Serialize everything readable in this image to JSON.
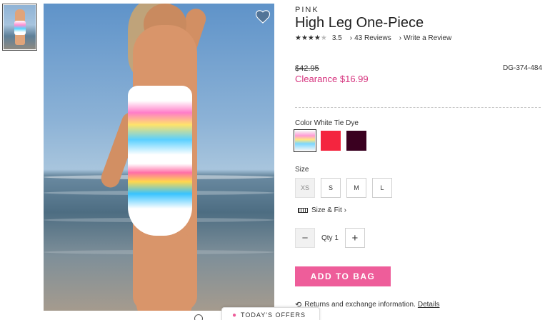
{
  "brand": "PINK",
  "product": {
    "title": "High Leg One-Piece",
    "rating": {
      "stars": "★★★",
      "half": "★",
      "empty": "★",
      "value": "3.5",
      "stars_value": 3.5
    },
    "reviews_link": "43 Reviews",
    "write_review_link": "Write a Review",
    "chevron": "›",
    "old_price": "$42.95",
    "clearance_price": "Clearance $16.99",
    "sku": "DG-374-484"
  },
  "color": {
    "label": "Color White Tie Dye",
    "swatches": [
      {
        "name": "White Tie Dye",
        "color": "#f6f6f6",
        "selected": true
      },
      {
        "name": "Red",
        "color": "#f4253f",
        "selected": false
      },
      {
        "name": "Burgundy",
        "color": "#3a0020",
        "selected": false
      }
    ]
  },
  "size": {
    "label": "Size",
    "options": [
      "XS",
      "S",
      "M",
      "L"
    ],
    "disabled": [
      "XS"
    ],
    "size_fit_link": "Size & Fit"
  },
  "quantity": {
    "minus": "−",
    "label": "Qty 1",
    "plus": "+"
  },
  "add_to_bag": "ADD TO BAG",
  "returns": {
    "text": "Returns and exchange information.",
    "link": "Details",
    "icon": "cycle-icon"
  },
  "offers_tab": "TODAY'S OFFERS",
  "icons": {
    "heart": "heart-icon",
    "ruler": "ruler-icon",
    "tag": "tag-icon",
    "zoom": "zoom-icon"
  },
  "colors": {
    "accent_pink": "#ee5d9a",
    "clearance": "#d6337e"
  }
}
